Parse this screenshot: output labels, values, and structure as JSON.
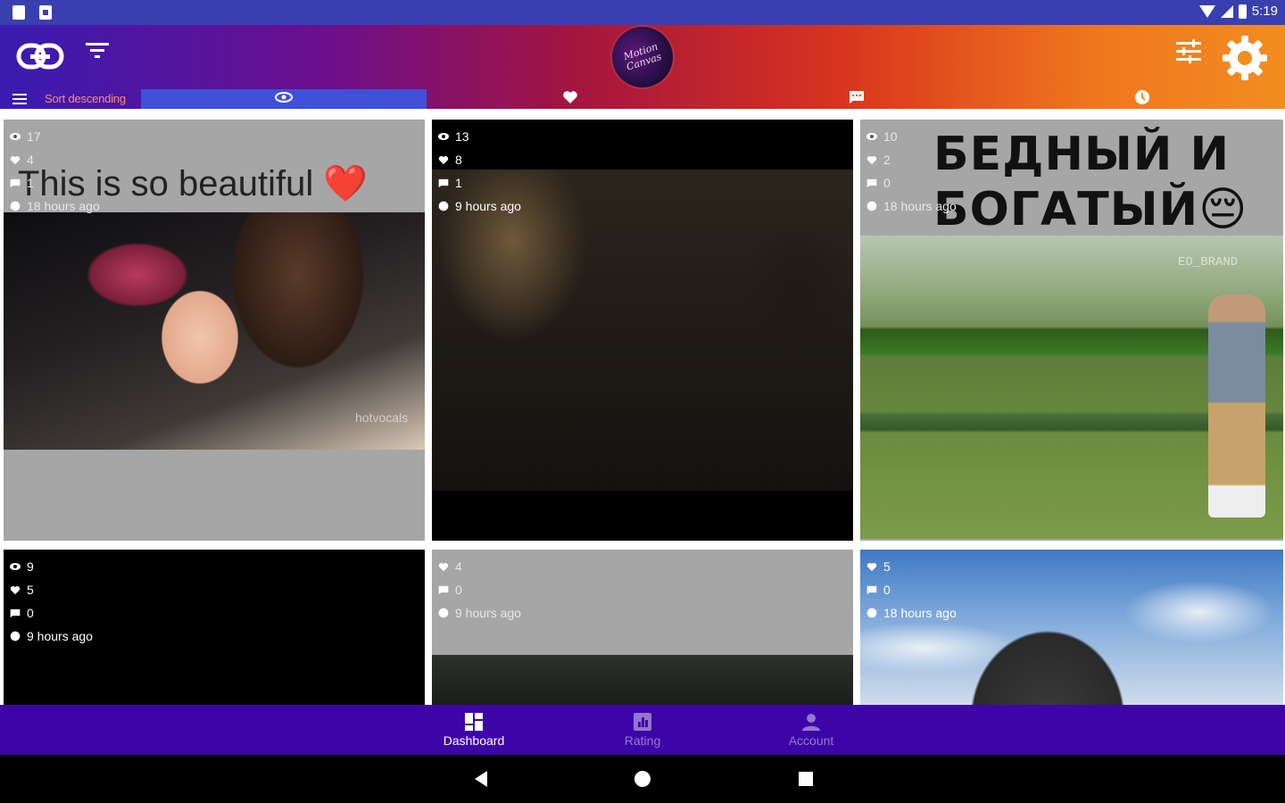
{
  "status_bar": {
    "time": "5:19"
  },
  "app_bar": {
    "logo_text": "Motion Canvas"
  },
  "sort_bar": {
    "label": "Sort descending"
  },
  "tabs": [
    {
      "key": "views",
      "icon": "eye-icon",
      "active": true
    },
    {
      "key": "likes",
      "icon": "heart-icon",
      "active": false
    },
    {
      "key": "comments",
      "icon": "comment-icon",
      "active": false
    },
    {
      "key": "time",
      "icon": "clock-icon",
      "active": false
    }
  ],
  "cards": [
    {
      "views": "17",
      "likes": "4",
      "comments": "1",
      "time": "18 hours ago",
      "caption": "This is so beautiful ❤️",
      "watermark": "hotvocals"
    },
    {
      "views": "13",
      "likes": "8",
      "comments": "1",
      "time": "9 hours ago"
    },
    {
      "views": "10",
      "likes": "2",
      "comments": "0",
      "time": "18 hours ago",
      "caption_line1": "БЕДНЫЙ И",
      "caption_line2": "БОГАТЫЙ😔",
      "watermark": "ED_BRAND"
    },
    {
      "views": "9",
      "likes": "5",
      "comments": "0",
      "time": "9 hours ago"
    },
    {
      "likes": "4",
      "comments": "0",
      "time": "9 hours ago"
    },
    {
      "likes": "5",
      "comments": "0",
      "time": "18 hours ago"
    }
  ],
  "bottom_nav": [
    {
      "label": "Dashboard",
      "icon": "dashboard-icon",
      "active": true
    },
    {
      "label": "Rating",
      "icon": "rating-icon",
      "active": false
    },
    {
      "label": "Account",
      "icon": "account-icon",
      "active": false
    }
  ],
  "colors": {
    "status_bar": "#3a3fb0",
    "gradient_start": "#3a1bb0",
    "gradient_end": "#f28d20",
    "active_tab": "#3f51d6",
    "bottom_nav": "#3d05a8"
  }
}
